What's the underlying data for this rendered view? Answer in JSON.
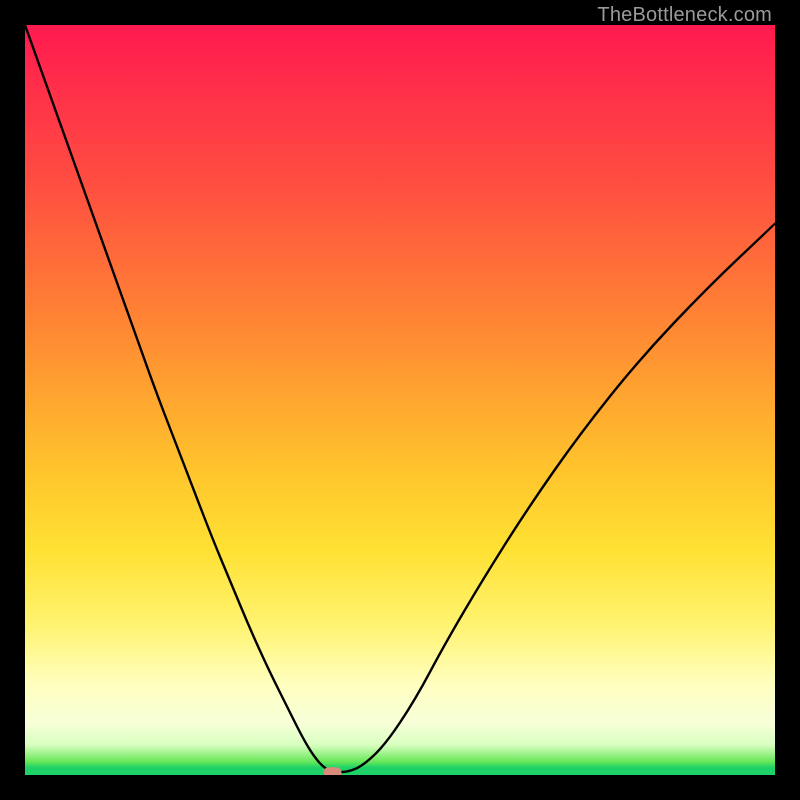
{
  "watermark": {
    "text": "TheBottleneck.com"
  },
  "chart_data": {
    "type": "line",
    "title": "",
    "xlabel": "",
    "ylabel": "",
    "xlim": [
      0,
      100
    ],
    "ylim": [
      0,
      100
    ],
    "grid": false,
    "legend": false,
    "background_gradient": {
      "direction": "vertical",
      "stops": [
        {
          "pos": 0.0,
          "color": "#ff1a50"
        },
        {
          "pos": 0.22,
          "color": "#ff5040"
        },
        {
          "pos": 0.48,
          "color": "#ffa030"
        },
        {
          "pos": 0.7,
          "color": "#ffe133"
        },
        {
          "pos": 0.88,
          "color": "#ffffc0"
        },
        {
          "pos": 0.96,
          "color": "#d8ffc0"
        },
        {
          "pos": 0.99,
          "color": "#1fd267"
        },
        {
          "pos": 1.0,
          "color": "#1fd267"
        }
      ]
    },
    "series": [
      {
        "name": "bottleneck-curve",
        "color": "#000000",
        "x": [
          0.0,
          2.5,
          5.0,
          7.5,
          10.0,
          12.5,
          15.0,
          17.5,
          20.0,
          22.5,
          25.0,
          27.5,
          30.0,
          32.5,
          35.0,
          37.0,
          38.5,
          40.0,
          41.5,
          43.0,
          45.0,
          48.0,
          52.0,
          56.0,
          61.0,
          67.0,
          74.0,
          82.0,
          91.0,
          100.0
        ],
        "y": [
          100.0,
          93.0,
          86.0,
          79.0,
          72.0,
          65.0,
          58.0,
          51.0,
          44.5,
          38.0,
          31.5,
          25.5,
          19.5,
          14.0,
          9.0,
          5.0,
          2.5,
          0.8,
          0.4,
          0.4,
          1.2,
          4.0,
          10.0,
          17.5,
          26.0,
          35.5,
          45.5,
          55.5,
          65.0,
          73.5
        ]
      }
    ],
    "markers": [
      {
        "name": "valley-marker",
        "x": 41.0,
        "y": 0.3,
        "color": "#d98a7a",
        "shape": "rounded-rect"
      }
    ],
    "valley_x": 41.0
  }
}
